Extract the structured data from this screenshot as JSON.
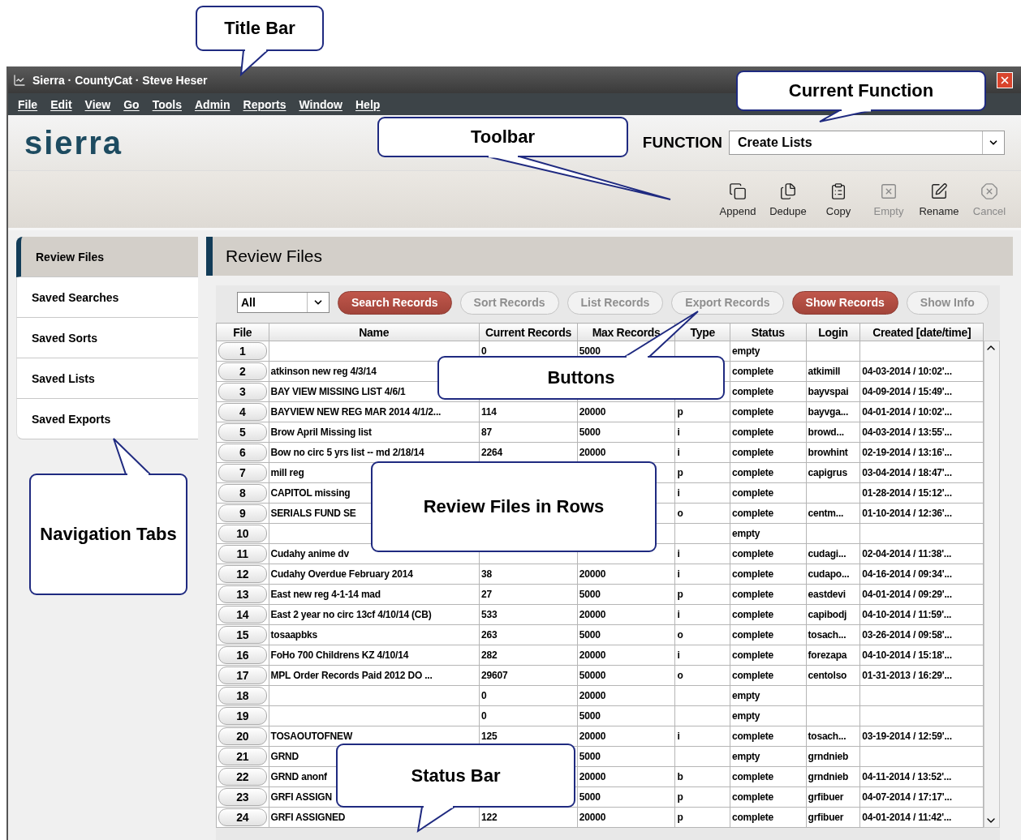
{
  "window": {
    "title": "Sierra · CountyCat · Steve Heser"
  },
  "menu": [
    "File",
    "Edit",
    "View",
    "Go",
    "Tools",
    "Admin",
    "Reports",
    "Window",
    "Help"
  ],
  "logo": "sierra",
  "function": {
    "label": "FUNCTION",
    "value": "Create Lists"
  },
  "toolbar": [
    {
      "label": "Append",
      "disabled": false
    },
    {
      "label": "Dedupe",
      "disabled": false
    },
    {
      "label": "Copy",
      "disabled": false
    },
    {
      "label": "Empty",
      "disabled": true
    },
    {
      "label": "Rename",
      "disabled": false
    },
    {
      "label": "Cancel",
      "disabled": true
    }
  ],
  "tabs": [
    {
      "label": "Review Files",
      "selected": true
    },
    {
      "label": "Saved Searches",
      "selected": false
    },
    {
      "label": "Saved Sorts",
      "selected": false
    },
    {
      "label": "Saved Lists",
      "selected": false
    },
    {
      "label": "Saved Exports",
      "selected": false
    }
  ],
  "panel_title": "Review Files",
  "filter": {
    "value": "All"
  },
  "actions": [
    {
      "label": "Search Records",
      "disabled": false
    },
    {
      "label": "Sort Records",
      "disabled": true
    },
    {
      "label": "List Records",
      "disabled": true
    },
    {
      "label": "Export Records",
      "disabled": true
    },
    {
      "label": "Show Records",
      "disabled": false
    },
    {
      "label": "Show Info",
      "disabled": true
    }
  ],
  "table": {
    "columns": [
      "File",
      "Name",
      "Current Records",
      "Max Records",
      "Type",
      "Status",
      "Login",
      "Created [date/time]"
    ],
    "rows": [
      [
        "1",
        "",
        "0",
        "5000",
        "",
        "empty",
        "",
        ""
      ],
      [
        "2",
        "atkinson new reg 4/3/14",
        "",
        "",
        "",
        "complete",
        "atkimill",
        "04-03-2014 / 10:02'..."
      ],
      [
        "3",
        "BAY VIEW MISSING LIST 4/6/1",
        "",
        "",
        "",
        "complete",
        "bayvspai",
        "04-09-2014 / 15:49'..."
      ],
      [
        "4",
        "BAYVIEW NEW REG MAR 2014 4/1/2...",
        "114",
        "20000",
        "p",
        "complete",
        "bayvga...",
        "04-01-2014 / 10:02'..."
      ],
      [
        "5",
        "Brow April Missing list",
        "87",
        "5000",
        "i",
        "complete",
        "browd...",
        "04-03-2014 / 13:55'..."
      ],
      [
        "6",
        "Bow no circ 5 yrs list --  md 2/18/14",
        "2264",
        "20000",
        "i",
        "complete",
        "browhint",
        "02-19-2014 / 13:16'..."
      ],
      [
        "7",
        "mill reg",
        "",
        "",
        "p",
        "complete",
        "capigrus",
        "03-04-2014 / 18:47'..."
      ],
      [
        "8",
        "CAPITOL missing",
        "",
        "",
        "i",
        "complete",
        "",
        "01-28-2014 / 15:12'..."
      ],
      [
        "9",
        "SERIALS FUND SE",
        "",
        "",
        "o",
        "complete",
        "centm...",
        "01-10-2014 / 12:36'..."
      ],
      [
        "10",
        "",
        "",
        "",
        "",
        "empty",
        "",
        ""
      ],
      [
        "11",
        "Cudahy anime dv",
        "",
        "",
        "i",
        "complete",
        "cudagi...",
        "02-04-2014 / 11:38'..."
      ],
      [
        "12",
        "Cudahy Overdue February 2014",
        "38",
        "20000",
        "i",
        "complete",
        "cudapo...",
        "04-16-2014 / 09:34'..."
      ],
      [
        "13",
        "East new reg 4-1-14 mad",
        "27",
        "5000",
        "p",
        "complete",
        "eastdevi",
        "04-01-2014 / 09:29'..."
      ],
      [
        "14",
        "East 2 year no circ 13cf 4/10/14 (CB)",
        "533",
        "20000",
        "i",
        "complete",
        "capibodj",
        "04-10-2014 / 11:59'..."
      ],
      [
        "15",
        "tosaapbks",
        "263",
        "5000",
        "o",
        "complete",
        "tosach...",
        "03-26-2014 / 09:58'..."
      ],
      [
        "16",
        "FoHo 700 Childrens KZ 4/10/14",
        "282",
        "20000",
        "i",
        "complete",
        "forezapa",
        "04-10-2014 / 15:18'..."
      ],
      [
        "17",
        "MPL Order Records Paid 2012 DO ...",
        "29607",
        "50000",
        "o",
        "complete",
        "centolso",
        "01-31-2013 / 16:29'..."
      ],
      [
        "18",
        "",
        "0",
        "20000",
        "",
        "empty",
        "",
        ""
      ],
      [
        "19",
        "",
        "0",
        "5000",
        "",
        "empty",
        "",
        ""
      ],
      [
        "20",
        "TOSAOUTOFNEW",
        "125",
        "20000",
        "i",
        "complete",
        "tosach...",
        "03-19-2014 / 12:59'..."
      ],
      [
        "21",
        "GRND",
        "",
        "5000",
        "",
        "empty",
        "grndnieb",
        ""
      ],
      [
        "22",
        "GRND anonf",
        "",
        "20000",
        "b",
        "complete",
        "grndnieb",
        "04-11-2014 / 13:52'..."
      ],
      [
        "23",
        "GRFI ASSIGN",
        "",
        "5000",
        "p",
        "complete",
        "grfibuer",
        "04-07-2014 / 17:17'..."
      ],
      [
        "24",
        "GRFI ASSIGNED",
        "122",
        "20000",
        "p",
        "complete",
        "grfibuer",
        "04-01-2014 / 11:42'..."
      ]
    ]
  },
  "callouts": [
    {
      "text": "Title Bar"
    },
    {
      "text": "Current Function"
    },
    {
      "text": "Toolbar"
    },
    {
      "text": "Buttons"
    },
    {
      "text": "Review Files in Rows"
    },
    {
      "text": "Navigation Tabs"
    },
    {
      "text": "Status Bar"
    }
  ]
}
